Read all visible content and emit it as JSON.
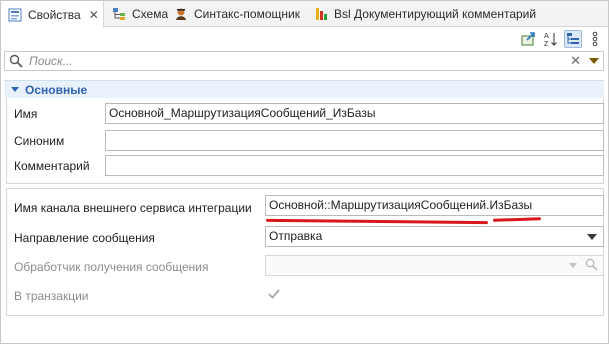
{
  "tabs": [
    {
      "label": "Свойства",
      "close": "✕"
    },
    {
      "label": "Схема"
    },
    {
      "label": "Синтакс-помощник"
    },
    {
      "label": "Bsl Документирующий комментарий"
    }
  ],
  "toolbar": {
    "sort_icon_text_top": "A",
    "sort_icon_text_bottom": "Z"
  },
  "search": {
    "placeholder": "Поиск...",
    "clear_glyph": "✕"
  },
  "section": {
    "title": "Основные"
  },
  "fields": {
    "name": {
      "label": "Имя",
      "value": "Основной_МаршрутизацияСообщений_ИзБазы"
    },
    "synonym": {
      "label": "Синоним",
      "value": ""
    },
    "comment": {
      "label": "Комментарий",
      "value": ""
    },
    "channel": {
      "label": "Имя канала внешнего сервиса интеграции",
      "value": "Основной::МаршрутизацияСообщений.ИзБазы"
    },
    "direction": {
      "label": "Направление сообщения",
      "value": "Отправка"
    },
    "handler": {
      "label": "Обработчик получения сообщения",
      "value": ""
    },
    "transaction": {
      "label": "В транзакции",
      "checked": true
    }
  },
  "colors": {
    "accent": "#2f63b0",
    "highlight_underline": "#d9161b"
  },
  "icons": [
    "properties-icon",
    "schema-icon",
    "syntax-helper-icon",
    "bsl-comment-icon",
    "export-icon",
    "sort-icon",
    "categories-icon",
    "menu-icon",
    "search-icon",
    "clear-icon",
    "dropdown-icon"
  ]
}
